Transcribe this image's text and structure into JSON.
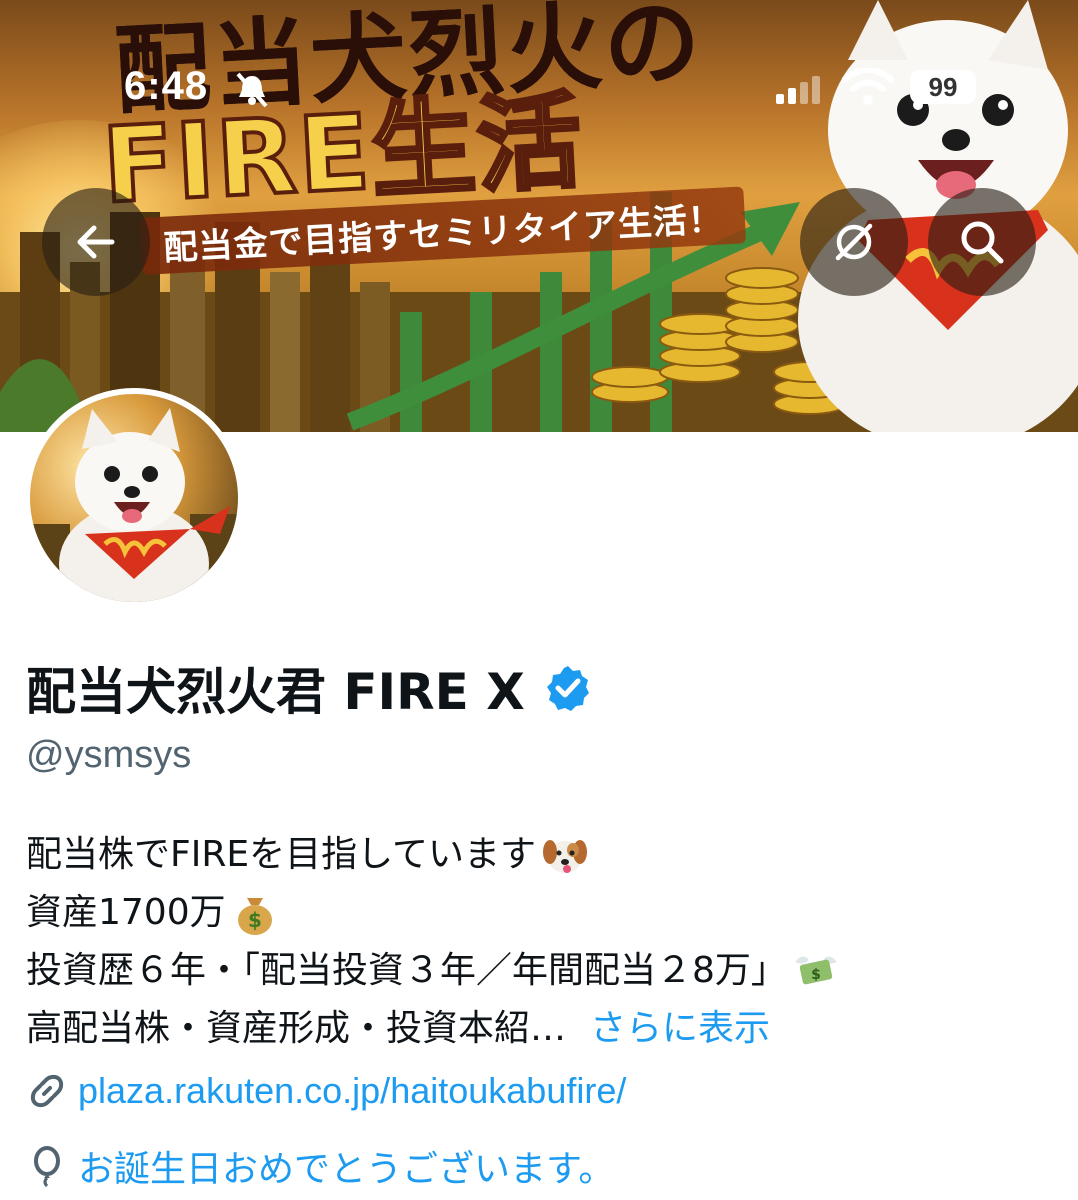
{
  "status_bar": {
    "time": "6:48",
    "battery": "99",
    "icons": [
      "bell-off-icon",
      "signal-icon",
      "wifi-icon",
      "battery-icon"
    ]
  },
  "banner": {
    "title_line1": "配当犬烈火の",
    "title_line2": "FIRE生活",
    "subtitle": "配当金で目指すセミリタイア生活！"
  },
  "nav": {
    "back_icon": "back-arrow-icon",
    "translate_icon": "no-sync-icon",
    "search_icon": "search-icon"
  },
  "profile": {
    "display_name": "配当犬烈火君 FIRE X",
    "verified": true,
    "handle": "@ysmsys",
    "bio": {
      "line1": "配当株でFIREを目指しています",
      "line2": "資産1700万",
      "line3": "投資歴６年・「配当投資３年／年間配当２8万」",
      "line4": "高配当株・資産形成・投資本紹…",
      "show_more": "さらに表示"
    },
    "website": "plaza.rakuten.co.jp/haitoukabufire/",
    "birthday": "お誕生日おめでとうございます。"
  },
  "colors": {
    "accent": "#1d9bf0",
    "secondary_text": "#536471",
    "primary_text": "#0f1419",
    "verified_badge": "#1d9bf0"
  }
}
